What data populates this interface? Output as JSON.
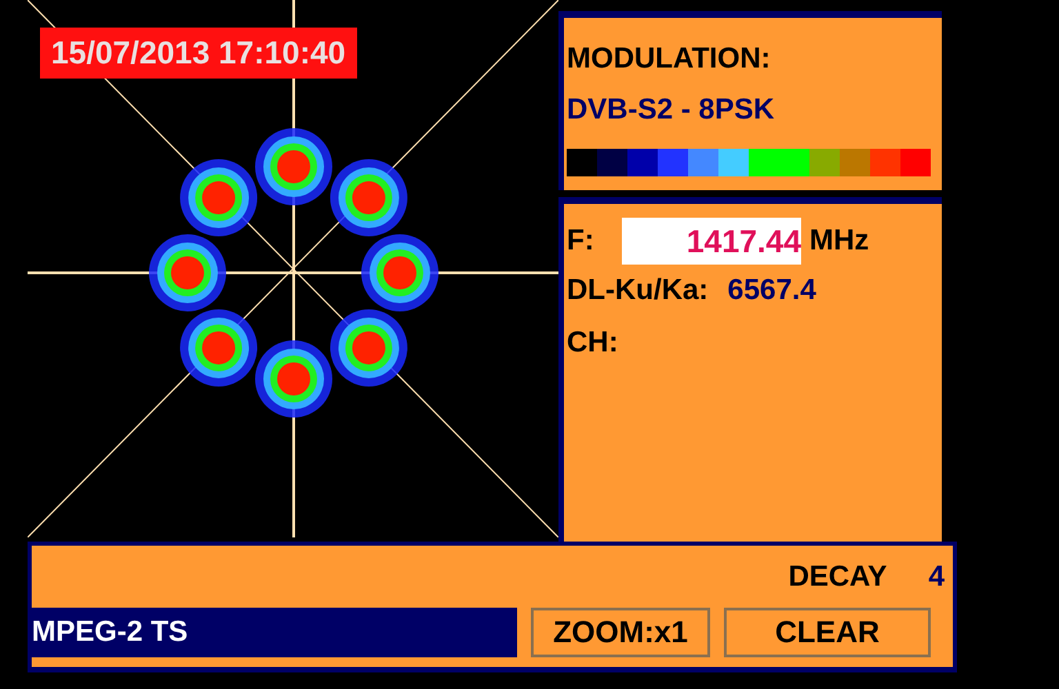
{
  "scope": {
    "timestamp": "15/07/2013 17:10:40"
  },
  "modulation": {
    "label": "MODULATION:",
    "value": "DVB-S2 - 8PSK",
    "legend": [
      {
        "color": "#000000"
      },
      {
        "color": "#000044"
      },
      {
        "color": "#0000aa"
      },
      {
        "color": "#2233ff"
      },
      {
        "color": "#4488ff"
      },
      {
        "color": "#44ccff"
      },
      {
        "color": "#00ff00"
      },
      {
        "color": "#00ff00"
      },
      {
        "color": "#88aa00"
      },
      {
        "color": "#bb7700"
      },
      {
        "color": "#ff3300"
      },
      {
        "color": "#ff0000"
      }
    ]
  },
  "frequency": {
    "label": "F:",
    "value": "1417.44",
    "unit": "MHz"
  },
  "readings": [
    {
      "label": "DL-Ku/Ka:",
      "value": "6567.4"
    },
    {
      "label": "CH:"
    }
  ],
  "decay": {
    "label": "DECAY",
    "value": "4"
  },
  "stream": "MPEG-2 TS",
  "buttons": [
    "ZOOM:x1",
    "CLEAR"
  ]
}
